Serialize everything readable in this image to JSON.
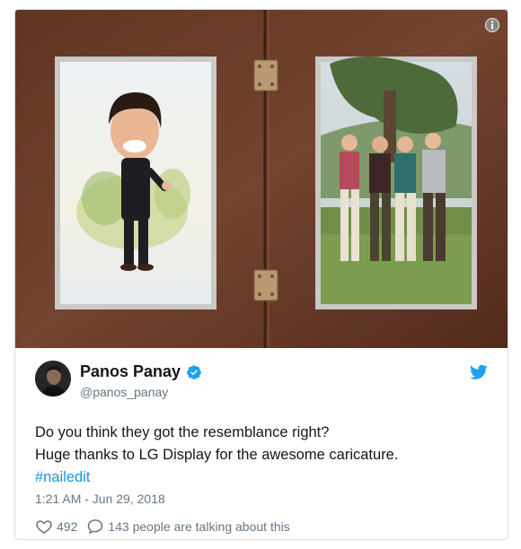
{
  "tweet": {
    "author_name": "Panos Panay",
    "author_handle": "@panos_panay",
    "text_lines": [
      "Do you think they got the resemblance right?",
      "Huge thanks to LG Display for the awesome caricature."
    ],
    "hashtag": "#nailedit",
    "timestamp": "1:21 AM - Jun 29, 2018",
    "like_count": "492",
    "reply_text": "143 people are talking about this"
  },
  "icons": {
    "info": "info-icon",
    "verified": "verified-badge-icon",
    "brand": "twitter-bird-icon",
    "like": "heart-icon",
    "reply": "speech-bubble-icon"
  },
  "colors": {
    "accent": "#1da1f2",
    "link": "#1b95e0",
    "text": "#14171a",
    "muted": "#657786"
  }
}
